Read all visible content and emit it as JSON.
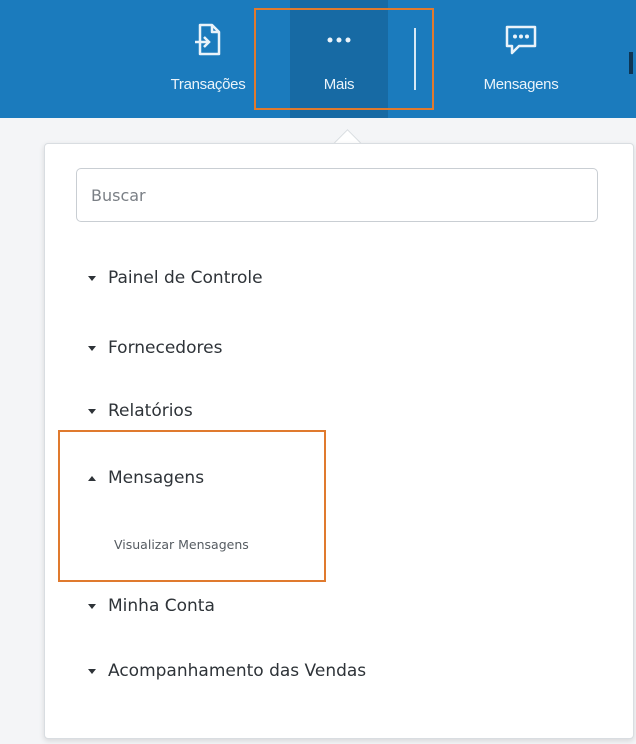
{
  "topnav": {
    "items": [
      {
        "label": "Transações",
        "icon": "document-arrow-icon"
      },
      {
        "label": "Mais",
        "icon": "more-dots-icon",
        "active": true
      },
      {
        "label": "Mensagens",
        "icon": "chat-bubble-icon"
      }
    ]
  },
  "dropdown": {
    "search_placeholder": "Buscar",
    "items": [
      {
        "label": "Painel de Controle",
        "expanded": false
      },
      {
        "label": "Fornecedores",
        "expanded": false
      },
      {
        "label": "Relatórios",
        "expanded": false
      },
      {
        "label": "Mensagens",
        "expanded": true,
        "children": [
          {
            "label": "Visualizar Mensagens"
          }
        ]
      },
      {
        "label": "Minha Conta",
        "expanded": false
      },
      {
        "label": "Acompanhamento das Vendas",
        "expanded": false
      }
    ]
  },
  "colors": {
    "topbar": "#1b7bbd",
    "topbar_active": "#176aa4",
    "highlight": "#e07a2e",
    "text": "#2e3338"
  }
}
